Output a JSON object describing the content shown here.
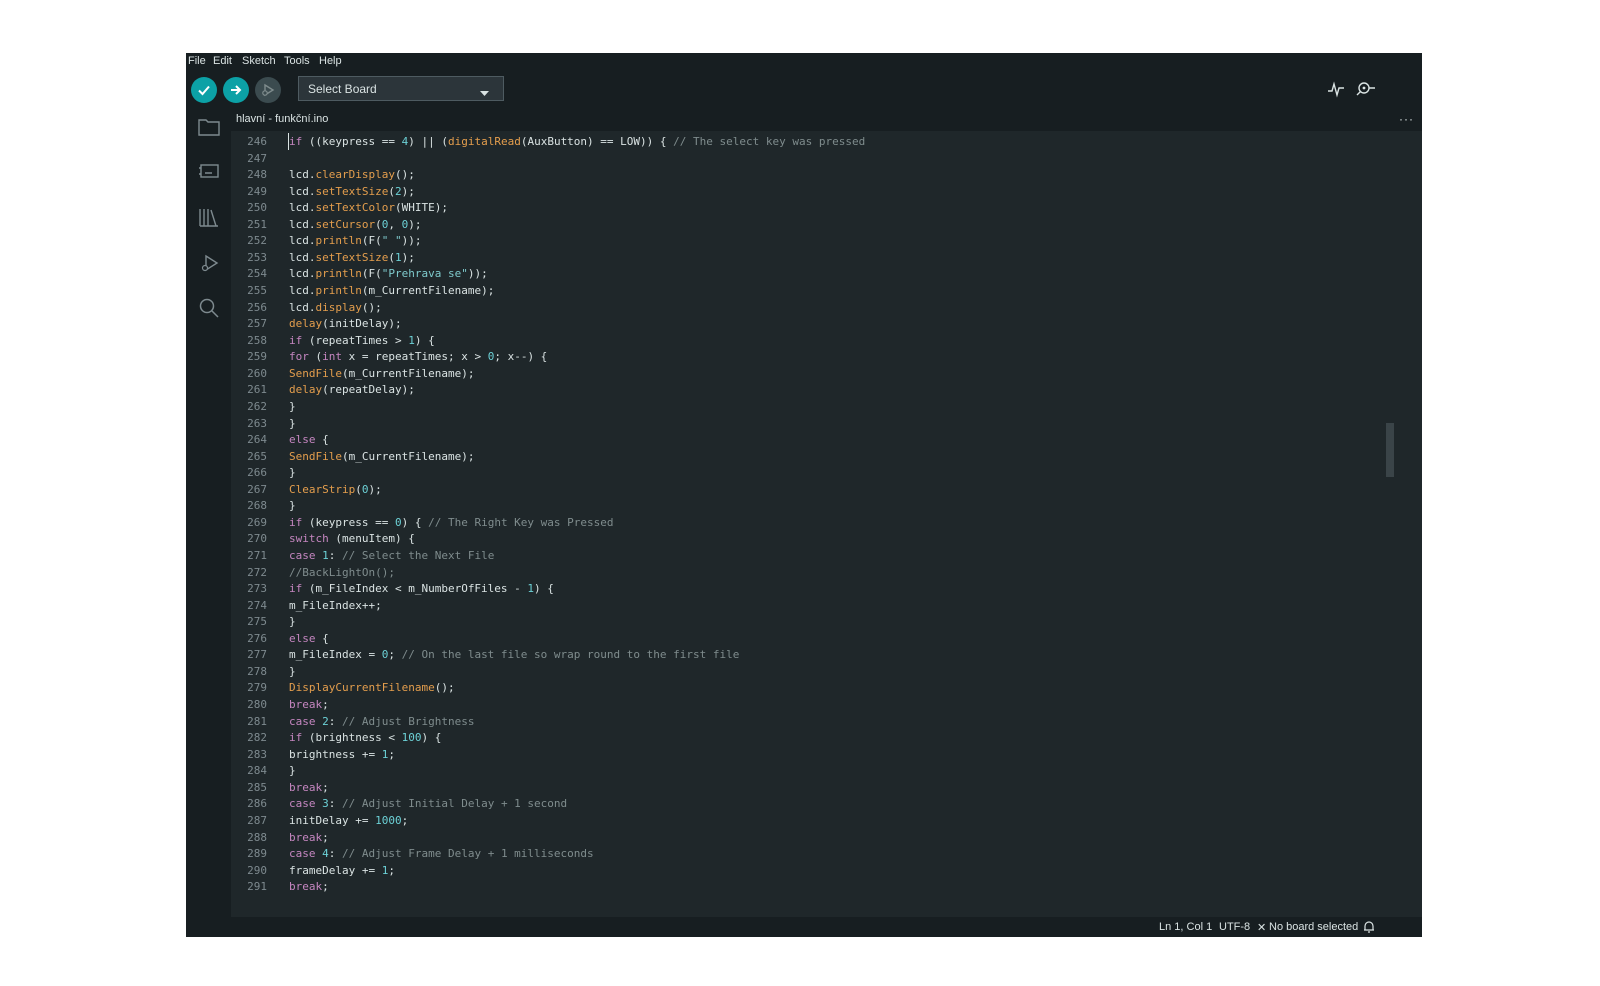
{
  "menu": {
    "items": [
      "File",
      "Edit",
      "Sketch",
      "Tools",
      "Help"
    ]
  },
  "toolbar": {
    "board_select_label": "Select Board"
  },
  "tab": {
    "filename": "hlavní - funkční.ino",
    "more": "···"
  },
  "status": {
    "position": "Ln 1, Col 1",
    "encoding": "UTF-8",
    "board": "No board selected"
  },
  "colors": {
    "accent": "#0ca1a6",
    "background": "#171e21",
    "editor_bg": "#1f272a",
    "text": "#dae3e3",
    "keyword": "#c586c0",
    "function": "#e49e4d",
    "number": "#6cd1d6",
    "comment": "#7f8c8d"
  },
  "icons": {
    "toolbar": [
      "verify-check-icon",
      "upload-arrow-icon",
      "debug-icon",
      "chevron-down-icon",
      "serial-plotter-icon",
      "serial-monitor-icon"
    ],
    "sidebar": [
      "folder-icon",
      "board-manager-icon",
      "library-icon",
      "debug-icon",
      "search-icon"
    ],
    "status": [
      "close-icon",
      "bell-icon"
    ]
  },
  "code": {
    "lines": [
      {
        "n": "246",
        "t": "if ((keypress == 4) || (digitalRead(AuxButton) == LOW)) { // The select key was pressed"
      },
      {
        "n": "247",
        "t": ""
      },
      {
        "n": "248",
        "t": "lcd.clearDisplay();"
      },
      {
        "n": "249",
        "t": "lcd.setTextSize(2);"
      },
      {
        "n": "250",
        "t": "lcd.setTextColor(WHITE);"
      },
      {
        "n": "251",
        "t": "lcd.setCursor(0, 0);"
      },
      {
        "n": "252",
        "t": "lcd.println(F(\" \"));"
      },
      {
        "n": "253",
        "t": "lcd.setTextSize(1);"
      },
      {
        "n": "254",
        "t": "lcd.println(F(\"Prehrava se\"));"
      },
      {
        "n": "255",
        "t": "lcd.println(m_CurrentFilename);"
      },
      {
        "n": "256",
        "t": "lcd.display();"
      },
      {
        "n": "257",
        "t": "delay(initDelay);"
      },
      {
        "n": "258",
        "t": "if (repeatTimes > 1) {"
      },
      {
        "n": "259",
        "t": "for (int x = repeatTimes; x > 0; x--) {"
      },
      {
        "n": "260",
        "t": "SendFile(m_CurrentFilename);"
      },
      {
        "n": "261",
        "t": "delay(repeatDelay);"
      },
      {
        "n": "262",
        "t": "}"
      },
      {
        "n": "263",
        "t": "}"
      },
      {
        "n": "264",
        "t": "else {"
      },
      {
        "n": "265",
        "t": "SendFile(m_CurrentFilename);"
      },
      {
        "n": "266",
        "t": "}"
      },
      {
        "n": "267",
        "t": "ClearStrip(0);"
      },
      {
        "n": "268",
        "t": "}"
      },
      {
        "n": "269",
        "t": "if (keypress == 0) { // The Right Key was Pressed"
      },
      {
        "n": "270",
        "t": "switch (menuItem) {"
      },
      {
        "n": "271",
        "t": "case 1: // Select the Next File"
      },
      {
        "n": "272",
        "t": "//BackLightOn();"
      },
      {
        "n": "273",
        "t": "if (m_FileIndex < m_NumberOfFiles - 1) {"
      },
      {
        "n": "274",
        "t": "m_FileIndex++;"
      },
      {
        "n": "275",
        "t": "}"
      },
      {
        "n": "276",
        "t": "else {"
      },
      {
        "n": "277",
        "t": "m_FileIndex = 0; // On the last file so wrap round to the first file"
      },
      {
        "n": "278",
        "t": "}"
      },
      {
        "n": "279",
        "t": "DisplayCurrentFilename();"
      },
      {
        "n": "280",
        "t": "break;"
      },
      {
        "n": "281",
        "t": "case 2: // Adjust Brightness"
      },
      {
        "n": "282",
        "t": "if (brightness < 100) {"
      },
      {
        "n": "283",
        "t": "brightness += 1;"
      },
      {
        "n": "284",
        "t": "}"
      },
      {
        "n": "285",
        "t": "break;"
      },
      {
        "n": "286",
        "t": "case 3: // Adjust Initial Delay + 1 second"
      },
      {
        "n": "287",
        "t": "initDelay += 1000;"
      },
      {
        "n": "288",
        "t": "break;"
      },
      {
        "n": "289",
        "t": "case 4: // Adjust Frame Delay + 1 milliseconds"
      },
      {
        "n": "290",
        "t": "frameDelay += 1;"
      },
      {
        "n": "291",
        "t": "break;"
      }
    ]
  }
}
